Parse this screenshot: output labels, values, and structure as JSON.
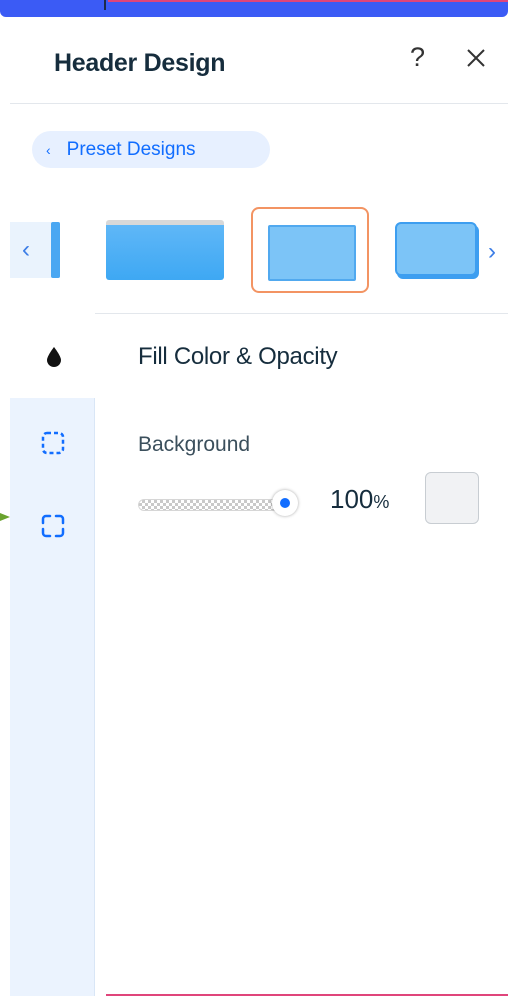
{
  "panel": {
    "title": "Header Design",
    "help_label": "?",
    "close_label": "close"
  },
  "presets": {
    "button_label": "Preset Designs",
    "back_chevron": "‹",
    "selected_index": 1
  },
  "carousel": {
    "prev_arrow": "‹",
    "next_arrow": "›"
  },
  "sidebar": {
    "items": [
      {
        "icon": "fill-drop-icon"
      },
      {
        "icon": "border-dashed-icon"
      },
      {
        "icon": "corners-icon"
      }
    ]
  },
  "fill_section": {
    "title": "Fill Color & Opacity",
    "background_label": "Background",
    "opacity_value": "100",
    "opacity_unit": "%",
    "opacity_level": 1.0,
    "swatch_color": "#f1f2f4"
  },
  "colors": {
    "accent": "#116dff",
    "selected_border": "#f39463",
    "thumb_blue": "#7cc4f7"
  }
}
